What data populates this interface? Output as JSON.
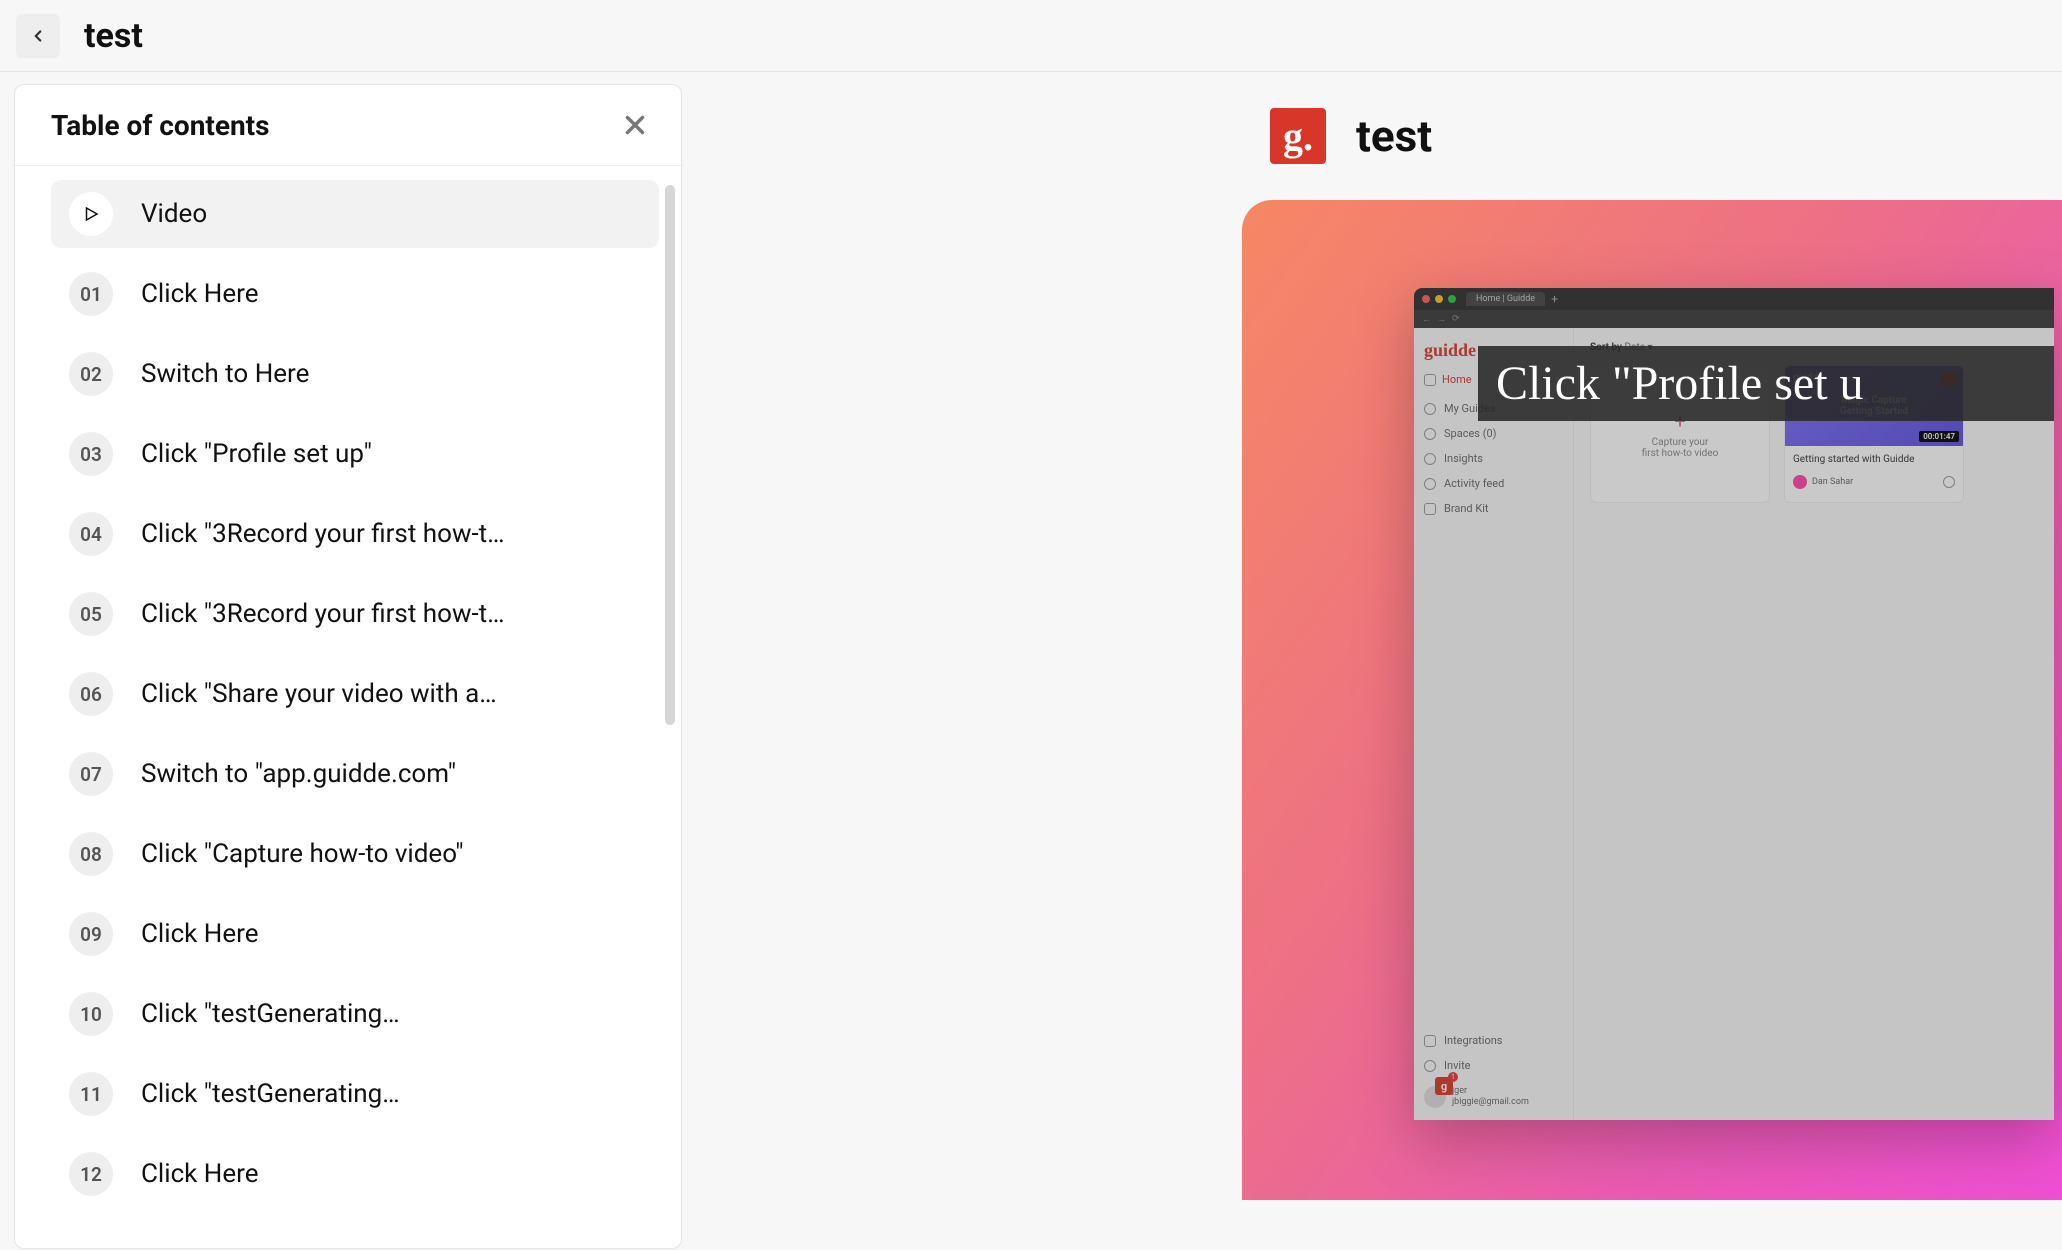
{
  "topbar": {
    "title": "test"
  },
  "toc": {
    "heading": "Table of contents",
    "video_label": "Video",
    "items": [
      {
        "num": "01",
        "label": "Click Here"
      },
      {
        "num": "02",
        "label": "Switch to Here"
      },
      {
        "num": "03",
        "label": "Click \"Profile set up\""
      },
      {
        "num": "04",
        "label": "Click \"3Record your first how-t…"
      },
      {
        "num": "05",
        "label": "Click \"3Record your first how-t…"
      },
      {
        "num": "06",
        "label": "Click \"Share your video with a…"
      },
      {
        "num": "07",
        "label": "Switch to \"app.guidde.com\""
      },
      {
        "num": "08",
        "label": "Click \"Capture how-to video\""
      },
      {
        "num": "09",
        "label": "Click Here"
      },
      {
        "num": "10",
        "label": "Click \"testGenerating…"
      },
      {
        "num": "11",
        "label": "Click \"testGenerating…"
      },
      {
        "num": "12",
        "label": "Click Here"
      }
    ]
  },
  "preview": {
    "title": "test",
    "logo_glyph": "g.",
    "overlay_caption": "Click \"Profile set u",
    "mock": {
      "tab_title": "Home | Guidde",
      "brand": "guidde",
      "nav_home": "Home",
      "nav_my_guides": "My Guides",
      "nav_spaces": "Spaces (0)",
      "nav_insights": "Insights",
      "nav_activity": "Activity feed",
      "nav_brand_kit": "Brand Kit",
      "nav_integrations": "Integrations",
      "nav_invite": "Invite",
      "user_name": "jger",
      "user_email": "jbiggie@gmail.com",
      "badge_count": "1",
      "sort_label": "Sort by",
      "sort_value": "Date",
      "capture_line1": "Capture your",
      "capture_line2": "first how-to video",
      "card_thumb_line1": "Magic Capture",
      "card_thumb_line2": "Getting Started",
      "duration": "00:01:47",
      "card_title": "Getting started with Guidde",
      "card_author": "Dan Sahar"
    }
  }
}
